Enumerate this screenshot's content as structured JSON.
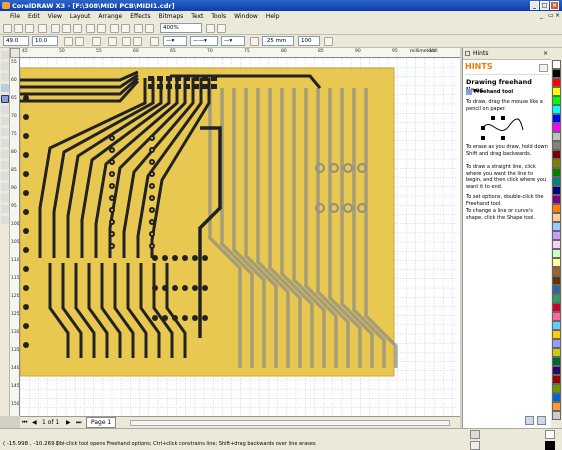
{
  "window": {
    "title": "CorelDRAW X3 - [F:\\308\\MIDI PCB\\MIDI1.cdr]"
  },
  "menu": [
    "File",
    "Edit",
    "View",
    "Layout",
    "Arrange",
    "Effects",
    "Bitmaps",
    "Text",
    "Tools",
    "Window",
    "Help"
  ],
  "toolbar": {
    "zoom": "400%"
  },
  "propertybar": {
    "x": "49.0",
    "y": "10.0",
    "outline_width": ".25 mm",
    "smoothing": "100"
  },
  "ruler": {
    "unit": "millimeters",
    "h_ticks": [
      "45",
      "50",
      "55",
      "60",
      "65",
      "70",
      "75",
      "80",
      "85",
      "90",
      "95",
      "100"
    ],
    "v_ticks": [
      "55",
      "60",
      "65",
      "70",
      "75",
      "80",
      "85",
      "90",
      "95",
      "100",
      "105",
      "110",
      "115",
      "120",
      "125",
      "130",
      "135",
      "140",
      "145",
      "150"
    ]
  },
  "hints": {
    "panel_label": "Hints",
    "title": "HINTS",
    "heading": "Drawing freehand lines",
    "tool_name": "Freehand tool",
    "items": [
      "To draw, drag the mouse like a pencil on paper.",
      "To erase as you draw, hold down Shift and drag backwards.",
      "To draw a straight line, click where you want the line to begin, and then click where you want it to end.",
      "To set options, double-click the Freehand tool.",
      "To change a line or curve's shape, click the Shape tool."
    ]
  },
  "pages": {
    "counter": "1 of 1",
    "tab": "Page 1"
  },
  "status": {
    "coords": "( -15.998 , -10.269 )",
    "message": "Dbl-click tool opens Freehand options; Ctrl+click constrains line; Shift+drag backwards over line erases"
  },
  "palette": [
    "#ffffff",
    "#000000",
    "#ff0000",
    "#ffff00",
    "#00ff00",
    "#00ffff",
    "#0000ff",
    "#ff00ff",
    "#c0c0c0",
    "#808080",
    "#800000",
    "#808000",
    "#008000",
    "#008080",
    "#000080",
    "#800080",
    "#ff8000",
    "#ffcc99",
    "#99ccff",
    "#cc99ff",
    "#ffccff",
    "#ccffcc",
    "#ffff99",
    "#996633",
    "#663300",
    "#336699",
    "#339966",
    "#cc0033",
    "#ff6699",
    "#66ccff",
    "#ffcc00",
    "#9999ff",
    "#cccc00",
    "#006633",
    "#330066",
    "#990000",
    "#669900",
    "#0066cc",
    "#ff9933",
    "#cccccc"
  ],
  "accent": {
    "pcb_fill": "#e8c850",
    "trace_dark": "#222222",
    "trace_ghost": "#8f8f84",
    "hint_orange": "#f07c00"
  }
}
